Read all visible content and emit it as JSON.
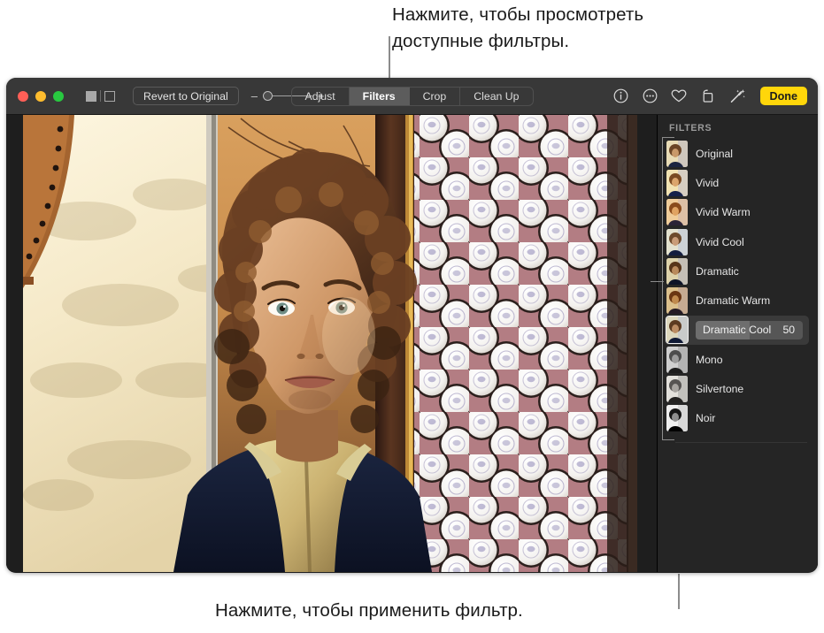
{
  "callouts": {
    "top": "Нажмите, чтобы просмотреть\nдоступные фильтры.",
    "bottom": "Нажмите, чтобы применить фильтр."
  },
  "toolbar": {
    "traffic_lights": [
      "close",
      "minimize",
      "zoom"
    ],
    "view_toggle": {
      "single_label": "single-view",
      "compare_label": "compare-view"
    },
    "revert_label": "Revert to Original",
    "zoom_slider": {
      "minus": "–",
      "plus": "+",
      "value": 0
    },
    "tabs": [
      {
        "label": "Adjust",
        "active": false
      },
      {
        "label": "Filters",
        "active": true
      },
      {
        "label": "Crop",
        "active": false
      },
      {
        "label": "Clean Up",
        "active": false
      }
    ],
    "icons": [
      "info-icon",
      "more-options-icon",
      "favorite-heart-icon",
      "rotate-icon",
      "auto-enhance-wand-icon"
    ],
    "done_label": "Done"
  },
  "sidebar": {
    "title": "FILTERS",
    "filters": [
      {
        "label": "Original",
        "selected": false,
        "value": null
      },
      {
        "label": "Vivid",
        "selected": false,
        "value": null
      },
      {
        "label": "Vivid Warm",
        "selected": false,
        "value": null
      },
      {
        "label": "Vivid Cool",
        "selected": false,
        "value": null
      },
      {
        "label": "Dramatic",
        "selected": false,
        "value": null
      },
      {
        "label": "Dramatic Warm",
        "selected": false,
        "value": null
      },
      {
        "label": "Dramatic Cool",
        "selected": true,
        "value": "50"
      },
      {
        "label": "Mono",
        "selected": false,
        "value": null
      },
      {
        "label": "Silvertone",
        "selected": false,
        "value": null
      },
      {
        "label": "Noir",
        "selected": false,
        "value": null
      }
    ]
  },
  "colors": {
    "accent": "#ffd60a",
    "toolbar_bg": "#383838",
    "sidebar_bg": "#252525",
    "window_bg": "#1e1e1e",
    "selected_row": "#3a3a3a"
  },
  "photo": {
    "description": "portrait-of-person-with-curly-hair-by-window"
  }
}
